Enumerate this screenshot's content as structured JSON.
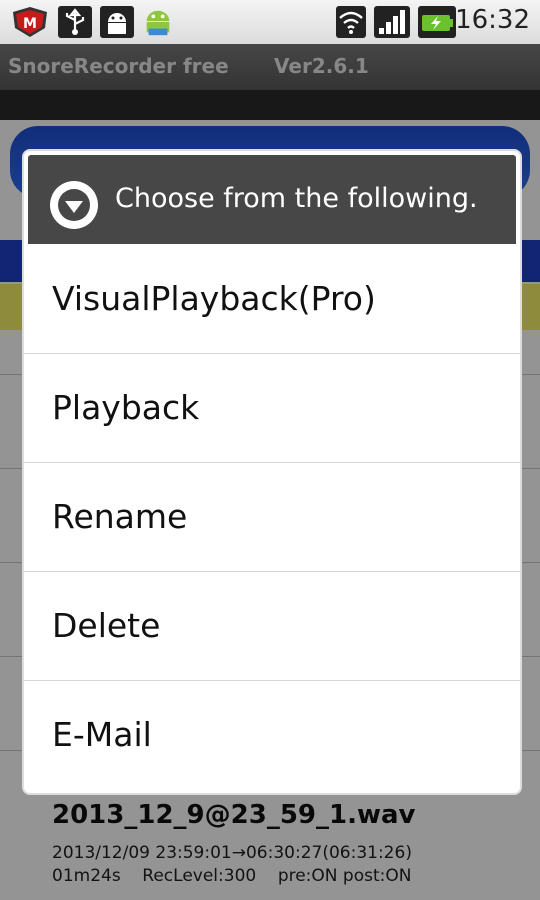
{
  "status_bar": {
    "time": "16:32",
    "icons": [
      "mcafee-icon",
      "usb-icon",
      "android-debug-icon",
      "android-app-icon",
      "wifi-icon",
      "signal-icon",
      "battery-charging-icon"
    ]
  },
  "app": {
    "title": "SnoreRecorder free",
    "version": "Ver2.6.1"
  },
  "dialog": {
    "title": "Choose from the following.",
    "items": [
      "VisualPlayback(Pro)",
      "Playback",
      "Rename",
      "Delete",
      "E-Mail"
    ]
  },
  "recording": {
    "name": "2013_12_9@23_59_1.wav",
    "time_range": "2013/12/09 23:59:01→06:30:27(06:31:26)",
    "details": "01m24s    RecLevel:300    pre:ON post:ON"
  },
  "colors": {
    "dialog_header": "#474747",
    "accent_blue": "#2f6df2",
    "accent_yellow": "#f6f06a"
  }
}
